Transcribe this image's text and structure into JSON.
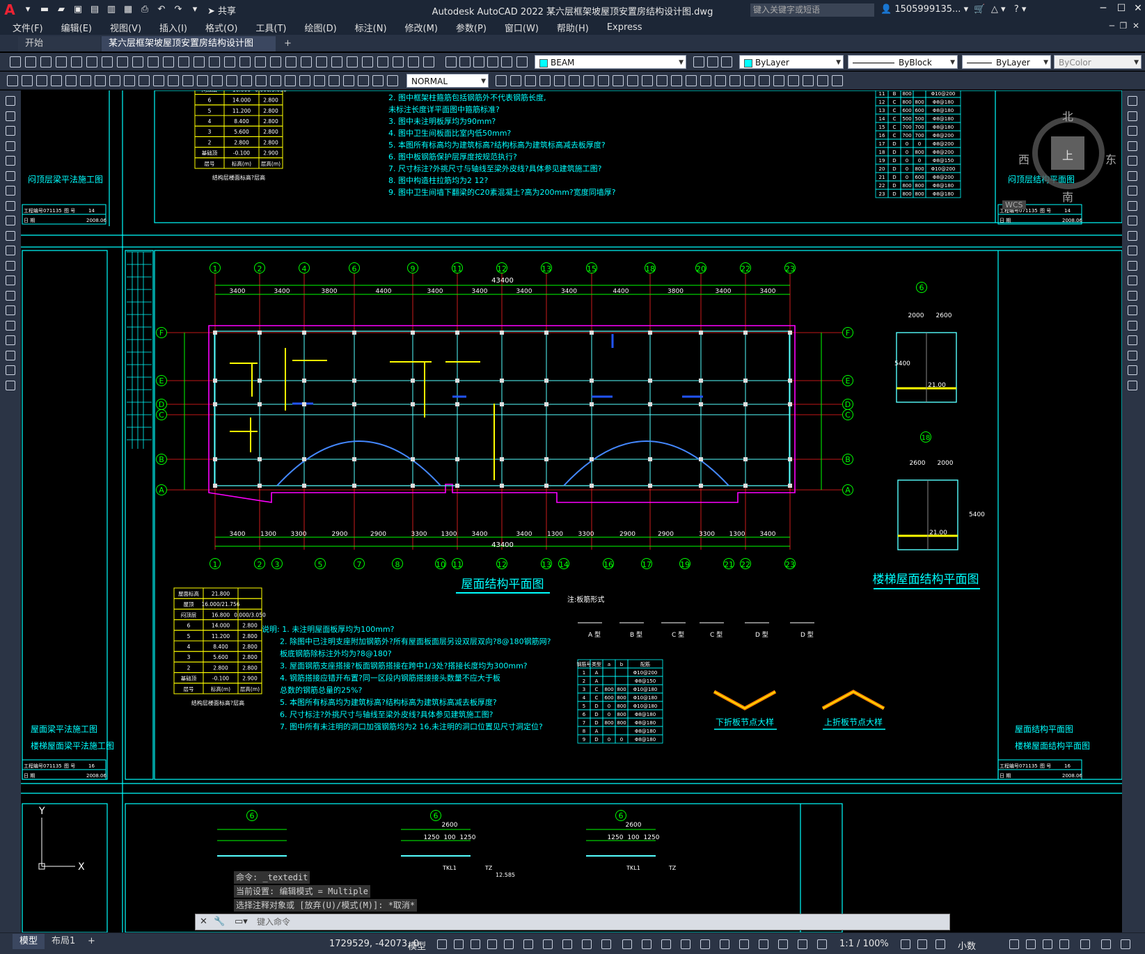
{
  "app": {
    "title": "Autodesk AutoCAD 2022    某六层框架坡屋顶安置房结构设计图.dwg",
    "share_label": "共享",
    "search_placeholder": "键入关键字或短语",
    "user": "1505999135...",
    "logo_letter": "A"
  },
  "menu": [
    "文件(F)",
    "编辑(E)",
    "视图(V)",
    "插入(I)",
    "格式(O)",
    "工具(T)",
    "绘图(D)",
    "标注(N)",
    "修改(M)",
    "参数(P)",
    "窗口(W)",
    "帮助(H)",
    "Express"
  ],
  "tabs": {
    "start": "开始",
    "drawing": "某六层框架坡屋顶安置房结构设计图*",
    "plus": "+"
  },
  "toolbar": {
    "layer": "BEAM",
    "color": "ByLayer",
    "linetype": "ByBlock",
    "lineweight": "ByLayer",
    "plotstyle": "ByColor",
    "textstyle": "NORMAL"
  },
  "viewcube": {
    "north": "北",
    "south": "南",
    "east": "东",
    "west": "西",
    "top": "上",
    "wcs": "WCS"
  },
  "drawing": {
    "main_title": "屋面结构平面图",
    "stair_title": "楼梯屋面结构平面图",
    "dim_total": "43400",
    "axes_top": [
      "1",
      "2",
      "4",
      "6",
      "9",
      "11",
      "12",
      "13",
      "15",
      "18",
      "20",
      "22",
      "23"
    ],
    "axes_bottom": [
      "1",
      "2",
      "3",
      "5",
      "7",
      "8",
      "10",
      "11",
      "12",
      "13",
      "14",
      "16",
      "17",
      "19",
      "21",
      "22",
      "23"
    ],
    "axes_rows": [
      "F",
      "E",
      "D",
      "C",
      "B",
      "A"
    ],
    "dims_top": [
      "3400",
      "3400",
      "3800",
      "4400",
      "3400",
      "3400",
      "3400",
      "3400",
      "4400",
      "3800",
      "3400",
      "3400"
    ],
    "dims_bottom": [
      "3400",
      "1300",
      "3300",
      "2900",
      "2900",
      "3300",
      "1300",
      "3400",
      "3400",
      "1300",
      "3300",
      "2900",
      "2900",
      "3300",
      "1300",
      "3400"
    ],
    "notes_top": [
      "2.  图中框架柱箍筋包括钢筋外不代表钢筋长度,",
      "     未标注长度详平面图中箍筋标准?",
      "3.  图中未注明板厚均为90mm?",
      "4.  图中卫生间板面比室内低50mm?",
      "5.  本图所有标高均为建筑标高?结构标高为建筑标高减去板厚度?",
      "6.  图中板钢筋保护层厚度按规范执行?",
      "7.  尺寸标注?外挑尺寸与轴线至梁外皮线?具体参见建筑施工图?",
      "8.  图中构造柱拉筋均为2  12?",
      "9.  图中卫生间墙下翻梁的C20素混凝土?高为200mm?宽度同墙厚?"
    ],
    "notes_bottom": [
      "说明:  1.  未注明屋面板厚均为100mm?",
      "2.  除图中已注明支座附加钢筋外?所有屋面板面层另设双层双向?8@180钢筋网?",
      "     板底钢筋除标注外均为?8@180?",
      "3.  屋面钢筋支座搭接?板面钢筋搭接在跨中1/3处?搭接长度均为300mm?",
      "4.  钢筋搭接应错开布置?同一区段内钢筋搭接接头数量不应大于板",
      "     总数的钢筋总量的25%?",
      "5.  本图所有标高均为建筑标高?结构标高为建筑标高减去板厚度?",
      "6.  尺寸标注?外挑尺寸与轴线至梁外皮线?具体参见建筑施工图?",
      "7.  图中所有未注明的洞口加强钢筋均为2  16,未注明的洞口位置见尺寸洞定位?"
    ],
    "left_titles_top": "闷顶层梁平法施工图",
    "left_titles_bottom": [
      "屋面梁平法施工图",
      "楼梯屋面梁平法施工图"
    ],
    "right_title_top": "闷顶层结构平面图",
    "right_titles_bottom": [
      "屋面结构平面图",
      "楼梯屋面结构平面图"
    ],
    "node_labels": [
      "下折板节点大样",
      "上折板节点大样"
    ],
    "slab_label": "注:板筋形式",
    "legend_floors": [
      [
        "屋面标高",
        "21.800",
        ""
      ],
      [
        "屋顶",
        "16.000/21.756",
        ""
      ],
      [
        "闷顶层",
        "16.800",
        "0.000/3.050"
      ],
      [
        "6",
        "14.000",
        "2.800"
      ],
      [
        "5",
        "11.200",
        "2.800"
      ],
      [
        "4",
        "8.400",
        "2.800"
      ],
      [
        "3",
        "5.600",
        "2.800"
      ],
      [
        "2",
        "2.800",
        "2.800"
      ],
      [
        "基础顶",
        "-0.100",
        "2.900"
      ],
      [
        "层号",
        "标高(m)",
        "层高(m)"
      ]
    ],
    "legend_caption": "结构层楼面标高?层高",
    "stamp": {
      "label1": "工程编号",
      "num": "071135",
      "label2": "图 号",
      "date_label": "日 期",
      "pages": [
        "14",
        "16"
      ],
      "date": "2008.06"
    },
    "rebar_table_header": [
      "钢筋号",
      "类型",
      "a",
      "b",
      "配筋"
    ],
    "rebar_table": [
      [
        "1",
        "A",
        "",
        "",
        "Φ10@200"
      ],
      [
        "2",
        "A",
        "",
        "",
        "Φ8@150"
      ],
      [
        "3",
        "C",
        "800",
        "800",
        "Φ10@180"
      ],
      [
        "4",
        "C",
        "600",
        "800",
        "Φ10@180"
      ],
      [
        "5",
        "D",
        "0",
        "800",
        "Φ10@180"
      ],
      [
        "6",
        "D",
        "0",
        "800",
        "Φ8@180"
      ],
      [
        "7",
        "D",
        "800",
        "800",
        "Φ8@180"
      ],
      [
        "8",
        "A",
        "",
        "",
        "Φ8@180"
      ],
      [
        "9",
        "D",
        "0",
        "0",
        "Φ8@180"
      ]
    ],
    "rebar_table_top": [
      [
        "11",
        "B",
        "800",
        "",
        "Φ10@200"
      ],
      [
        "12",
        "C",
        "800",
        "800",
        "Φ8@180"
      ],
      [
        "13",
        "C",
        "600",
        "600",
        "Φ8@180"
      ],
      [
        "14",
        "C",
        "500",
        "500",
        "Φ8@180"
      ],
      [
        "15",
        "C",
        "700",
        "700",
        "Φ8@180"
      ],
      [
        "16",
        "C",
        "700",
        "700",
        "Φ8@200"
      ],
      [
        "17",
        "D",
        "0",
        "0",
        "Φ8@200"
      ],
      [
        "18",
        "D",
        "0",
        "800",
        "Φ8@200"
      ],
      [
        "19",
        "D",
        "0",
        "0",
        "Φ8@150"
      ],
      [
        "20",
        "D",
        "0",
        "800",
        "Φ10@200"
      ],
      [
        "21",
        "D",
        "0",
        "600",
        "Φ8@200"
      ],
      [
        "22",
        "D",
        "800",
        "800",
        "Φ8@180"
      ],
      [
        "23",
        "D",
        "800",
        "800",
        "Φ8@180"
      ]
    ],
    "stair_dims": [
      "2000",
      "2600",
      "5400",
      "21.00"
    ],
    "stair_dims2": [
      "2600",
      "2000",
      "5400",
      "21.00"
    ],
    "bottom_dims": [
      "2600",
      "1250",
      "100",
      "1250",
      "2600",
      "1250",
      "100",
      "1250"
    ],
    "bottom_labels": [
      "TKL1",
      "TZ",
      "12.585",
      "TKL1",
      "TZ"
    ]
  },
  "command": {
    "history": [
      "命令: _textedit",
      "当前设置: 编辑模式 = Multiple",
      "选择注释对象或 [放弃(U)/模式(M)]: *取消*"
    ],
    "placeholder": "键入命令"
  },
  "status": {
    "model_tab": "模型",
    "layout_tab": "布局1",
    "plus": "+",
    "coords": "1729529, -42073, 0",
    "model": "模型",
    "scale": "1:1 / 100%",
    "units": "小数"
  },
  "colors": {
    "accent": "#00ffff",
    "axis_red": "#ff2222",
    "beam_cyan": "#5ff",
    "dim_green": "#00ff00",
    "magenta": "#ff00ff",
    "yellow": "#ffff00",
    "blue": "#2255ff"
  }
}
